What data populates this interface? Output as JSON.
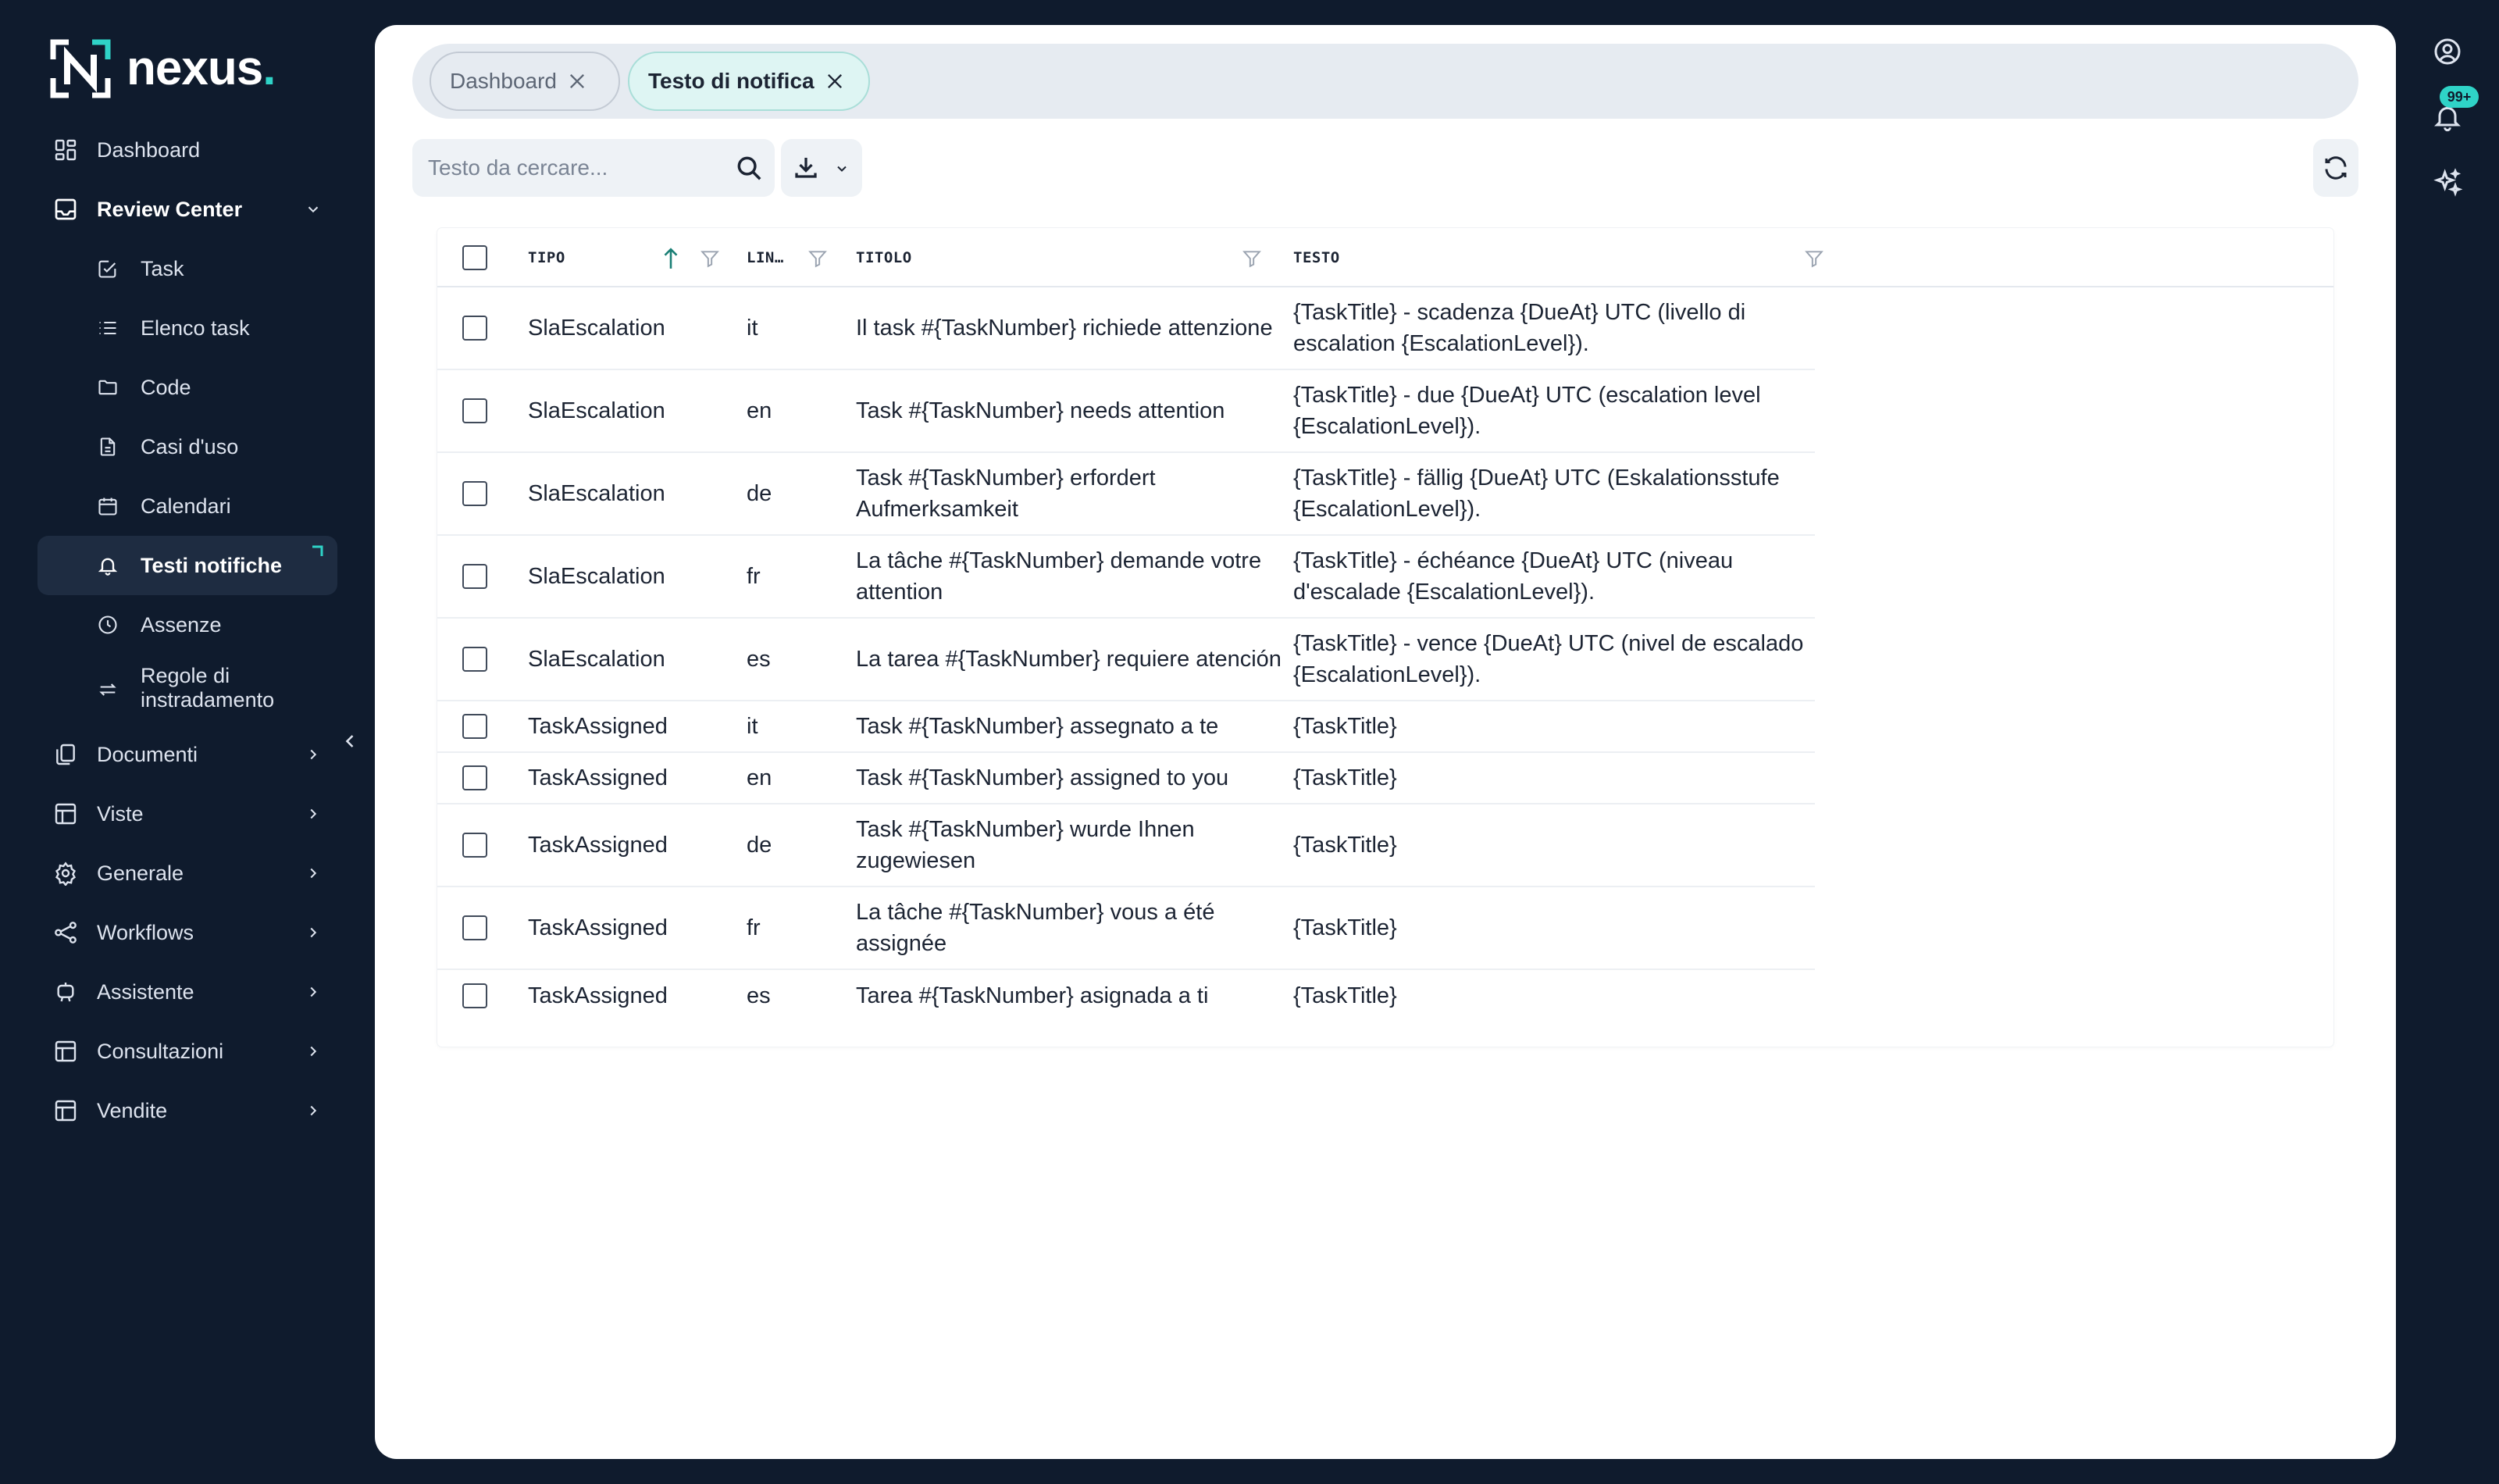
{
  "brand": {
    "name": "nexus",
    "dot": "."
  },
  "sidebar": {
    "items": [
      {
        "label": "Dashboard"
      },
      {
        "label": "Review Center"
      },
      {
        "label": "Task"
      },
      {
        "label": "Elenco task"
      },
      {
        "label": "Code"
      },
      {
        "label": "Casi d'uso"
      },
      {
        "label": "Calendari"
      },
      {
        "label": "Testi notifiche"
      },
      {
        "label": "Assenze"
      },
      {
        "label": "Regole di instradamento"
      },
      {
        "label": "Documenti"
      },
      {
        "label": "Viste"
      },
      {
        "label": "Generale"
      },
      {
        "label": "Workflows"
      },
      {
        "label": "Assistente"
      },
      {
        "label": "Consultazioni"
      },
      {
        "label": "Vendite"
      }
    ]
  },
  "tabs": [
    {
      "label": "Dashboard"
    },
    {
      "label": "Testo di notifica"
    }
  ],
  "search": {
    "placeholder": "Testo da cercare...",
    "value": ""
  },
  "table": {
    "columns": {
      "tipo": "TIPO",
      "lingua": "LIN…",
      "titolo": "TITOLO",
      "testo": "TESTO"
    },
    "rows": [
      {
        "tipo": "SlaEscalation",
        "lingua": "it",
        "titolo": "Il task #{TaskNumber} richiede attenzione",
        "testo": "{TaskTitle} - scadenza {DueAt} UTC (livello di escalation {EscalationLevel})."
      },
      {
        "tipo": "SlaEscalation",
        "lingua": "en",
        "titolo": "Task #{TaskNumber} needs attention",
        "testo": "{TaskTitle} - due {DueAt} UTC (escalation level {EscalationLevel})."
      },
      {
        "tipo": "SlaEscalation",
        "lingua": "de",
        "titolo": "Task #{TaskNumber} erfordert Aufmerksamkeit",
        "testo": "{TaskTitle} - fällig {DueAt} UTC (Eskalationsstufe {EscalationLevel})."
      },
      {
        "tipo": "SlaEscalation",
        "lingua": "fr",
        "titolo": "La tâche #{TaskNumber} demande votre attention",
        "testo": "{TaskTitle} - échéance {DueAt} UTC (niveau d'escalade {EscalationLevel})."
      },
      {
        "tipo": "SlaEscalation",
        "lingua": "es",
        "titolo": "La tarea #{TaskNumber} requiere atención",
        "testo": "{TaskTitle} - vence {DueAt} UTC (nivel de escalado {EscalationLevel})."
      },
      {
        "tipo": "TaskAssigned",
        "lingua": "it",
        "titolo": "Task #{TaskNumber} assegnato a te",
        "testo": "{TaskTitle}"
      },
      {
        "tipo": "TaskAssigned",
        "lingua": "en",
        "titolo": "Task #{TaskNumber} assigned to you",
        "testo": "{TaskTitle}"
      },
      {
        "tipo": "TaskAssigned",
        "lingua": "de",
        "titolo": "Task #{TaskNumber} wurde Ihnen zugewiesen",
        "testo": "{TaskTitle}"
      },
      {
        "tipo": "TaskAssigned",
        "lingua": "fr",
        "titolo": "La tâche #{TaskNumber} vous a été assignée",
        "testo": "{TaskTitle}"
      },
      {
        "tipo": "TaskAssigned",
        "lingua": "es",
        "titolo": "Tarea #{TaskNumber} asignada a ti",
        "testo": "{TaskTitle}"
      }
    ]
  },
  "notifications": {
    "badge": "99+"
  },
  "colors": {
    "accent": "#2fd3c7",
    "sidebar_bg": "#0f1b2d",
    "active_item_bg": "#1e2c41"
  }
}
